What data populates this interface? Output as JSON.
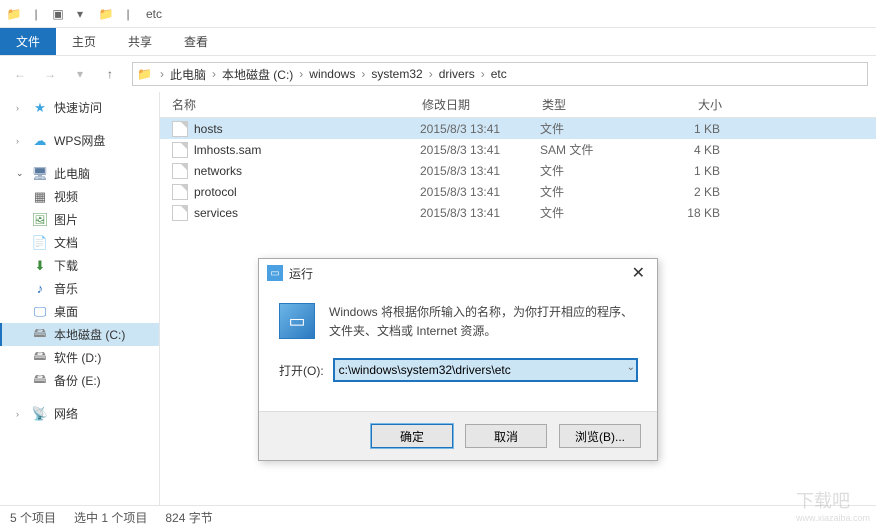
{
  "titlebar": {
    "title": "etc"
  },
  "ribbon": {
    "tabs": [
      {
        "label": "文件",
        "active": true
      },
      {
        "label": "主页"
      },
      {
        "label": "共享"
      },
      {
        "label": "查看"
      }
    ]
  },
  "breadcrumb": {
    "items": [
      "此电脑",
      "本地磁盘 (C:)",
      "windows",
      "system32",
      "drivers",
      "etc"
    ]
  },
  "sidebar": {
    "quick_access": "快速访问",
    "wps": "WPS网盘",
    "this_pc": "此电脑",
    "video": "视频",
    "pictures": "图片",
    "documents": "文档",
    "downloads": "下载",
    "music": "音乐",
    "desktop": "桌面",
    "drive_c": "本地磁盘 (C:)",
    "drive_d": "软件 (D:)",
    "drive_e": "备份 (E:)",
    "network": "网络"
  },
  "columns": {
    "name": "名称",
    "date": "修改日期",
    "type": "类型",
    "size": "大小"
  },
  "files": [
    {
      "name": "hosts",
      "date": "2015/8/3 13:41",
      "type": "文件",
      "size": "1 KB",
      "selected": true
    },
    {
      "name": "lmhosts.sam",
      "date": "2015/8/3 13:41",
      "type": "SAM 文件",
      "size": "4 KB"
    },
    {
      "name": "networks",
      "date": "2015/8/3 13:41",
      "type": "文件",
      "size": "1 KB"
    },
    {
      "name": "protocol",
      "date": "2015/8/3 13:41",
      "type": "文件",
      "size": "2 KB"
    },
    {
      "name": "services",
      "date": "2015/8/3 13:41",
      "type": "文件",
      "size": "18 KB"
    }
  ],
  "statusbar": {
    "count": "5 个项目",
    "selected": "选中 1 个项目",
    "bytes": "824 字节"
  },
  "run_dialog": {
    "title": "运行",
    "description": "Windows 将根据你所输入的名称，为你打开相应的程序、文件夹、文档或 Internet 资源。",
    "open_label": "打开(O):",
    "value": "c:\\windows\\system32\\drivers\\etc",
    "ok": "确定",
    "cancel": "取消",
    "browse": "浏览(B)..."
  },
  "watermark": {
    "line1": "下载吧",
    "line2": "www.xiazaiba.com"
  }
}
